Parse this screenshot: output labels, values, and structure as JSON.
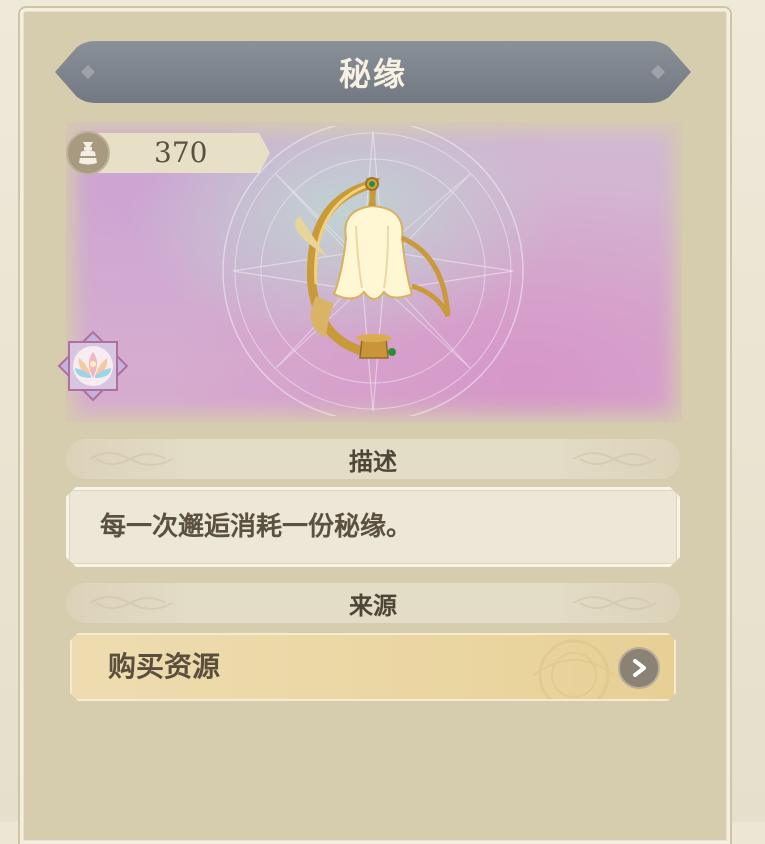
{
  "item": {
    "title": "秘缘",
    "count": "370",
    "count_icon": "pouch-icon",
    "image": "golden-lantern",
    "badge_icon": "lotus-rarity-badge"
  },
  "description": {
    "header": "描述",
    "text": "每一次邂逅消耗一份秘缘。"
  },
  "source": {
    "header": "来源",
    "items": [
      {
        "label": "购买资源",
        "icon": "chevron-right-icon"
      }
    ]
  },
  "colors": {
    "panel": "#d6ccae",
    "title_banner": "#7f868e",
    "button": "#ead59f",
    "text": "#5a4f3c"
  }
}
